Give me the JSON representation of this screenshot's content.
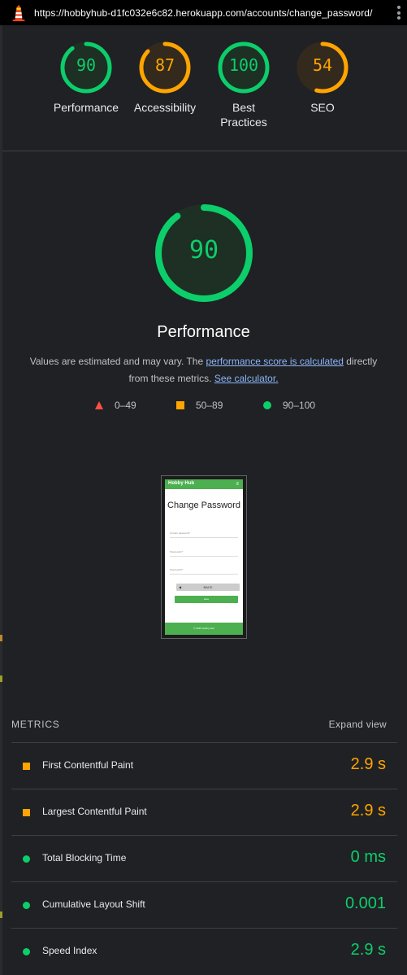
{
  "browser": {
    "url": "https://hobbyhub-d1fc032e6c82.herokuapp.com/accounts/change_password/"
  },
  "colors": {
    "good": "#0cce6b",
    "average": "#ffa400",
    "poor": "#ff4e42"
  },
  "summary": [
    {
      "score": "90",
      "label": "Performance",
      "rating": "good"
    },
    {
      "score": "87",
      "label": "Accessibility",
      "rating": "average"
    },
    {
      "score": "100",
      "label": "Best Practices",
      "rating": "good"
    },
    {
      "score": "54",
      "label": "SEO",
      "rating": "average"
    }
  ],
  "performance": {
    "score": "90",
    "title": "Performance",
    "desc_prefix": "Values are estimated and may vary. The ",
    "desc_link1": "performance score is calculated",
    "desc_middle": " directly from these metrics. ",
    "desc_link2": "See calculator."
  },
  "legend": [
    {
      "range": "0–49",
      "shape": "triangle-icon"
    },
    {
      "range": "50–89",
      "shape": "square-icon"
    },
    {
      "range": "90–100",
      "shape": "circle-icon"
    }
  ],
  "screenshot": {
    "brand": "Hobby Hub",
    "menu_icon": "≡",
    "title": "Change Password",
    "field1": "Current password*",
    "field2": "Password1*",
    "field3": "Password2*",
    "back_label": "BACK",
    "save_label": "save",
    "footer": "© 2025 Hobby Hub"
  },
  "metrics": {
    "title": "METRICS",
    "expand": "Expand view",
    "items": [
      {
        "label": "First Contentful Paint",
        "value": "2.9 s",
        "rating": "average"
      },
      {
        "label": "Largest Contentful Paint",
        "value": "2.9 s",
        "rating": "average"
      },
      {
        "label": "Total Blocking Time",
        "value": "0 ms",
        "rating": "good"
      },
      {
        "label": "Cumulative Layout Shift",
        "value": "0.001",
        "rating": "good"
      },
      {
        "label": "Speed Index",
        "value": "2.9 s",
        "rating": "good"
      }
    ]
  }
}
